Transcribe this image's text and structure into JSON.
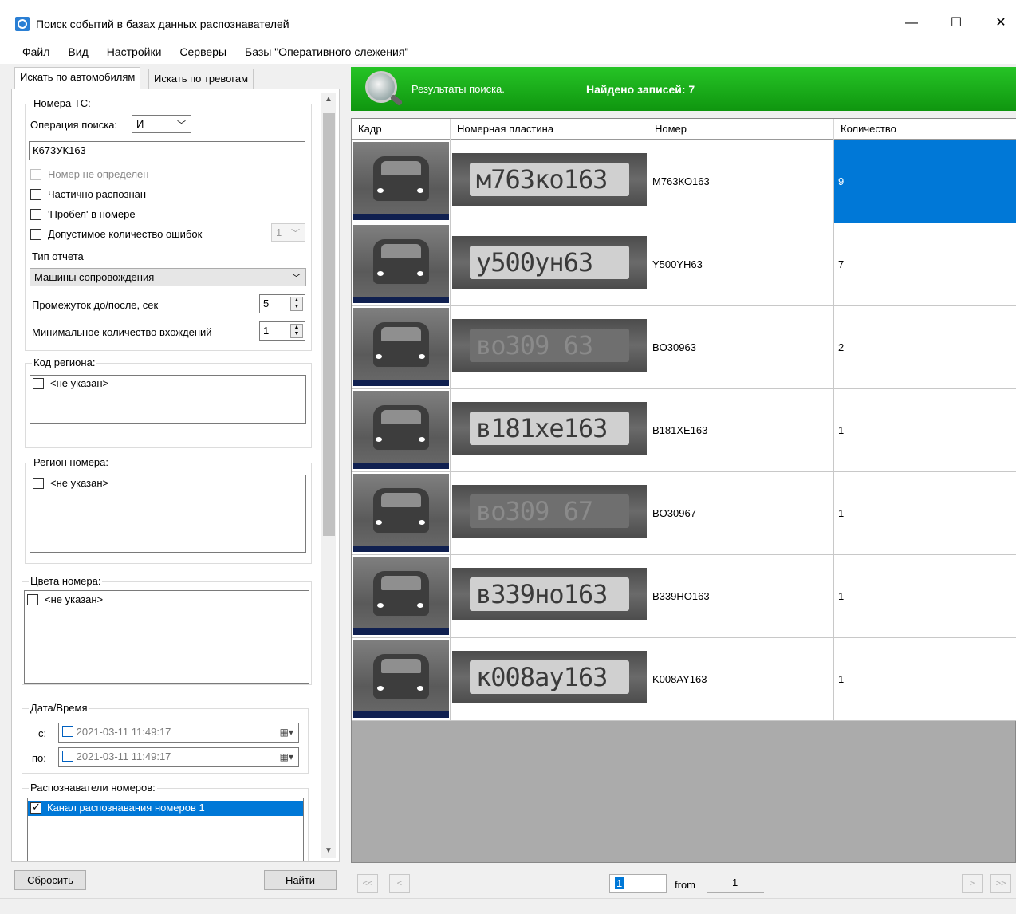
{
  "window": {
    "title": "Поиск событий в базах данных распознавателей",
    "minimize": "—",
    "maximize": "☐",
    "close": "✕"
  },
  "menu": [
    "Файл",
    "Вид",
    "Настройки",
    "Серверы",
    "Базы \"Оперативного слежения\""
  ],
  "tabs": [
    "Искать по автомобилям",
    "Искать по тревогам"
  ],
  "filters": {
    "plate_group": "Номера ТС:",
    "op_label": "Операция поиска:",
    "op_value": "И",
    "plate_input": "К673УК163",
    "chk_undefined": "Номер не определен",
    "chk_partial": "Частично распознан",
    "chk_space": "'Пробел' в номере",
    "chk_errors": "Допустимое количество ошибок",
    "errors_value": "1",
    "report_type_label": "Тип отчета",
    "report_type_value": "Машины сопровождения",
    "interval_label": "Промежуток до/после, сек",
    "interval_value": "5",
    "min_count_label": "Минимальное количество вхождений",
    "min_count_value": "1",
    "region_code_group": "Код региона:",
    "region_code_item": "<не указан>",
    "plate_region_group": "Регион номера:",
    "plate_region_item": "<не указан>",
    "colors_group": "Цвета номера:",
    "colors_item": "<не указан>",
    "datetime_group": "Дата/Время",
    "from_label": "с:",
    "from_value": "2021-03-11 11:49:17",
    "to_label": "по:",
    "to_value": "2021-03-11 11:49:17",
    "recognizers_group": "Распознаватели номеров:",
    "recognizer_item": "Канал распознавания номеров 1"
  },
  "buttons": {
    "reset": "Сбросить",
    "find": "Найти"
  },
  "banner": {
    "results": "Результаты поиска.",
    "found": "Найдено записей: 7"
  },
  "grid": {
    "headers": [
      "Кадр",
      "Номерная пластина",
      "Номер",
      "Количество"
    ],
    "rows": [
      {
        "plate": "М763КО163",
        "qty": "9",
        "plate_img": "м763ко163"
      },
      {
        "plate": "Y500YH63",
        "qty": "7",
        "plate_img": "у500ун63"
      },
      {
        "plate": "BO30963",
        "qty": "2",
        "plate_img": "во309 63"
      },
      {
        "plate": "B181XE163",
        "qty": "1",
        "plate_img": "в181хе163"
      },
      {
        "plate": "BO30967",
        "qty": "1",
        "plate_img": "во309 67"
      },
      {
        "plate": "B339HO163",
        "qty": "1",
        "plate_img": "в339но163"
      },
      {
        "plate": "K008AY163",
        "qty": "1",
        "plate_img": "к008ау163"
      }
    ]
  },
  "pager": {
    "first": "<<",
    "prev": "<",
    "page": "1",
    "from_label": "from",
    "total": "1",
    "next": ">",
    "last": ">>"
  },
  "colors": {
    "banner": "#1aab1a",
    "selection": "#0078d7"
  }
}
